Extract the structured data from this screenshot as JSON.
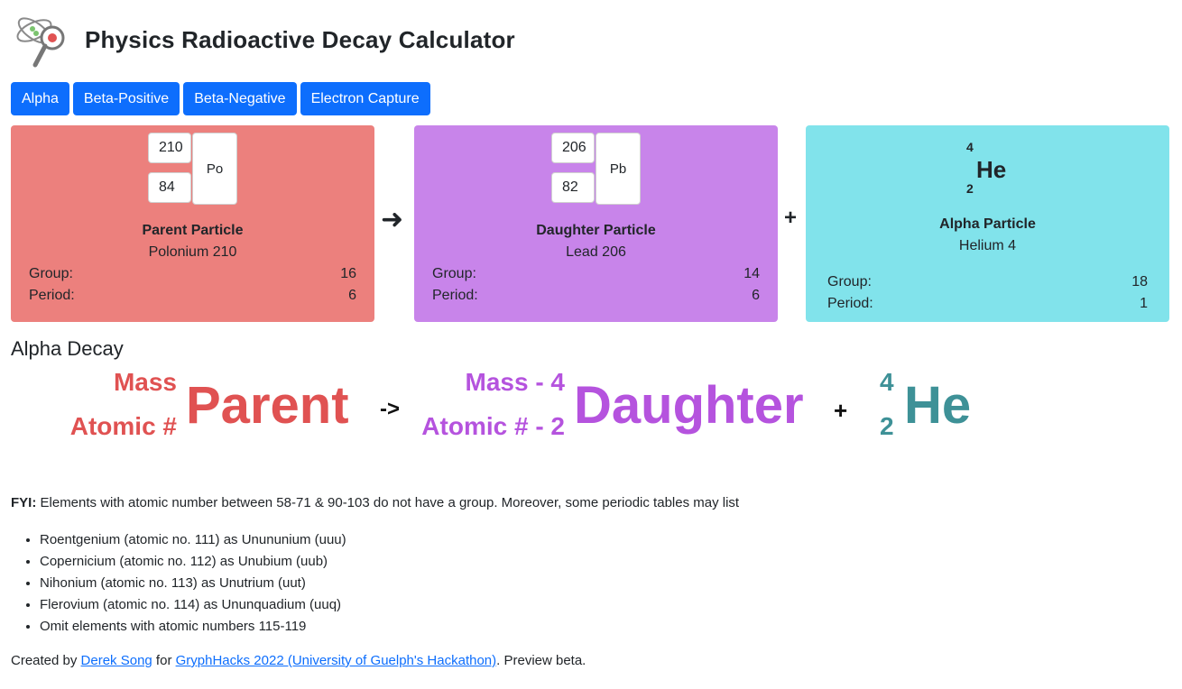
{
  "header": {
    "title": "Physics Radioactive Decay Calculator",
    "logo_icon": "atom-magnifier-icon"
  },
  "tabs": [
    "Alpha",
    "Beta-Positive",
    "Beta-Negative",
    "Electron Capture"
  ],
  "cards": {
    "parent": {
      "mass": "210",
      "atomic": "84",
      "symbol": "Po",
      "label": "Parent Particle",
      "name": "Polonium 210",
      "group_label": "Group:",
      "group": "16",
      "period_label": "Period:",
      "period": "6"
    },
    "arrow": "➜",
    "daughter": {
      "mass": "206",
      "atomic": "82",
      "symbol": "Pb",
      "label": "Daughter Particle",
      "name": "Lead 206",
      "group_label": "Group:",
      "group": "14",
      "period_label": "Period:",
      "period": "6"
    },
    "plus": "+",
    "alpha": {
      "mass": "4",
      "atomic": "2",
      "symbol": "He",
      "label": "Alpha Particle",
      "name": "Helium 4",
      "group_label": "Group:",
      "group": "18",
      "period_label": "Period:",
      "period": "1"
    }
  },
  "equation": {
    "title": "Alpha Decay",
    "parent_mass": "Mass",
    "parent_atomic": "Atomic #",
    "parent": "Parent",
    "arrow": "->",
    "daughter_mass": "Mass - 4",
    "daughter_atomic": "Atomic # - 2",
    "daughter": "Daughter",
    "plus": "+",
    "he_mass": "4",
    "he_atomic": "2",
    "he": "He"
  },
  "fyi": {
    "label": "FYI:",
    "text": " Elements with atomic number between 58-71 & 90-103 do not have a group. Moreover, some periodic tables may list"
  },
  "notes": [
    "Roentgenium (atomic no. 111) as Unununium (uuu)",
    "Copernicium (atomic no. 112) as Unubium (uub)",
    "Nihonium (atomic no. 113) as Unutrium (uut)",
    "Flerovium (atomic no. 114) as Ununquadium (uuq)",
    "Omit elements with atomic numbers 115-119"
  ],
  "footer": {
    "prefix": "Created by ",
    "author": "Derek Song",
    "mid": " for ",
    "event": "GryphHacks 2022 (University of Guelph's Hackathon)",
    "suffix": ". Preview beta."
  },
  "colors": {
    "accent": "#0d6efd",
    "parent": "#ec807d",
    "daughter": "#c884ea",
    "alpha": "#81e3eb"
  }
}
